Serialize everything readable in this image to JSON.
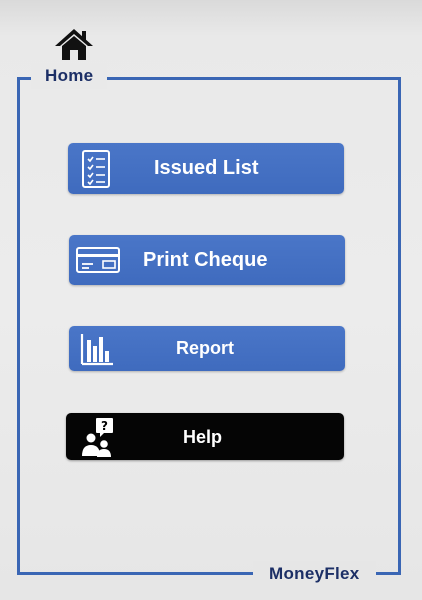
{
  "header": {
    "home_icon": "home-icon",
    "home_label": "Home"
  },
  "menu": {
    "items": [
      {
        "id": "issued-list",
        "label": "Issued List",
        "icon": "checklist-icon",
        "color": "#3f6bbe"
      },
      {
        "id": "print-cheque",
        "label": "Print Cheque",
        "icon": "cheque-icon",
        "color": "#3f6bbe"
      },
      {
        "id": "report",
        "label": "Report",
        "icon": "bar-chart-icon",
        "color": "#3f6bbe"
      },
      {
        "id": "help",
        "label": "Help",
        "icon": "help-people-icon",
        "color": "#050505"
      }
    ]
  },
  "footer": {
    "brand": "MoneyFlex"
  },
  "colors": {
    "accent": "#3a66b4",
    "text_dark": "#1c2f66",
    "button_blue": "#3f6bbe",
    "button_black": "#050505"
  }
}
